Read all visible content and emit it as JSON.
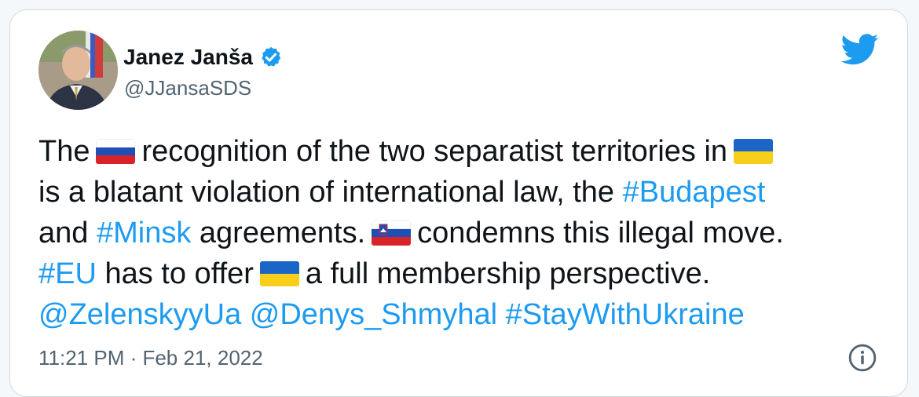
{
  "author": {
    "name": "Janez Janša",
    "handle": "@JJansaSDS",
    "avatar_icon": "profile-photo",
    "verified_icon": "verified-badge-icon"
  },
  "brand": {
    "logo_icon": "twitter-bird-icon",
    "accent_color": "#1d9bf0"
  },
  "tweet": {
    "line1": {
      "t1": "The",
      "flag1": "russia-flag-icon",
      "t2": "recognition of the two separatist territories in",
      "flag2": "ukraine-flag-icon"
    },
    "line2": {
      "t1": "is a blatant violation of international law, the",
      "hashtag1": "#Budapest"
    },
    "line3": {
      "t1": "and",
      "hashtag1": "#Minsk",
      "t2": "agreements.",
      "flag1": "slovenia-flag-icon",
      "t3": "condemns this illegal move."
    },
    "line4": {
      "hashtag1": "#EU",
      "t1": "has to offer",
      "flag1": "ukraine-flag-icon",
      "t2": "a full membership perspective."
    },
    "line5": {
      "mention1": "@ZelenskyyUa",
      "mention2": "@Denys_Shmyhal",
      "hashtag1": "#StayWithUkraine"
    }
  },
  "footer": {
    "timestamp": "11:21 PM · Feb 21, 2022",
    "info_icon": "info-icon"
  }
}
